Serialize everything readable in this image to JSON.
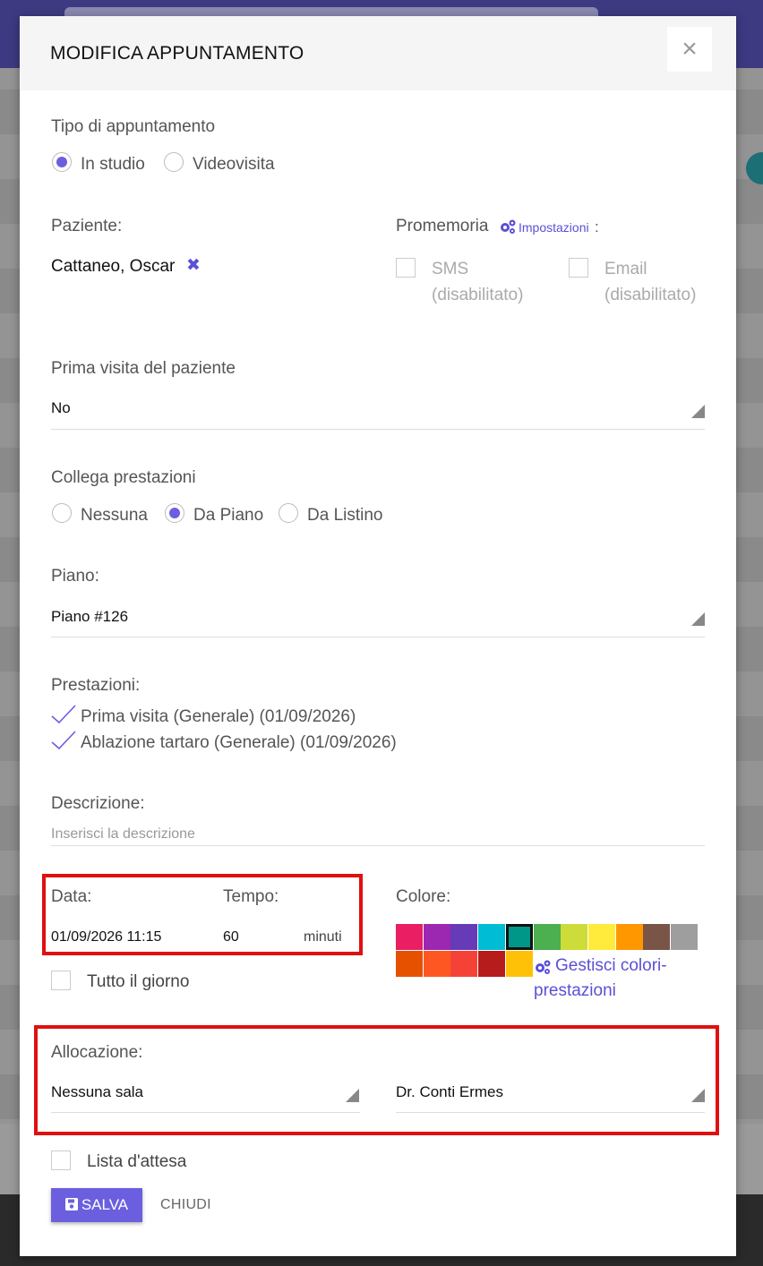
{
  "modal": {
    "title": "MODIFICA APPUNTAMENTO",
    "close_icon": "×"
  },
  "appointment_type": {
    "label": "Tipo di appuntamento",
    "options": [
      "In studio",
      "Videovisita"
    ],
    "selected": "In studio"
  },
  "patient": {
    "label": "Paziente:",
    "name": "Cattaneo, Oscar",
    "remove_icon": "✖"
  },
  "reminder": {
    "label": "Promemoria",
    "settings_link": "Impostazioni",
    "suffix": ":",
    "sms_label": "SMS",
    "sms_state": "(disabilitato)",
    "email_label": "Email",
    "email_state": "(disabilitato)"
  },
  "first_visit": {
    "label": "Prima visita del paziente",
    "value": "No"
  },
  "link_services": {
    "label": "Collega prestazioni",
    "options": [
      "Nessuna",
      "Da Piano",
      "Da Listino"
    ],
    "selected": "Da Piano"
  },
  "plan": {
    "label": "Piano:",
    "value": "Piano #126"
  },
  "services": {
    "label": "Prestazioni:",
    "items": [
      "Prima visita (Generale) (01/09/2026)",
      "Ablazione tartaro (Generale) (01/09/2026)"
    ]
  },
  "description": {
    "label": "Descrizione:",
    "placeholder": "Inserisci la descrizione"
  },
  "date": {
    "label": "Data:",
    "value": "01/09/2026 11:15"
  },
  "duration": {
    "label": "Tempo:",
    "value": "60",
    "unit": "minuti"
  },
  "all_day": {
    "label": "Tutto il giorno"
  },
  "color": {
    "label": "Colore:",
    "swatches": [
      "#e91e63",
      "#9c27b0",
      "#673ab7",
      "#00bcd4",
      "#009688",
      "#4caf50",
      "#cddc39",
      "#ffeb3b",
      "#ff9800",
      "#795548",
      "#9e9e9e",
      "#e65100",
      "#ff5722",
      "#f44336",
      "#b71c1c",
      "#ffc107"
    ],
    "selected": "#009688",
    "manage_link": "Gestisci colori-",
    "manage_link_2": "prestazioni"
  },
  "allocation": {
    "label": "Allocazione:",
    "room": "Nessuna sala",
    "doctor": "Dr. Conti Ermes"
  },
  "waiting_list": {
    "label": "Lista d'attesa"
  },
  "actions": {
    "save": "SALVA",
    "close": "CHIUDI"
  },
  "colors": {
    "accent": "#6b5fe0",
    "highlight": "#e01010"
  }
}
